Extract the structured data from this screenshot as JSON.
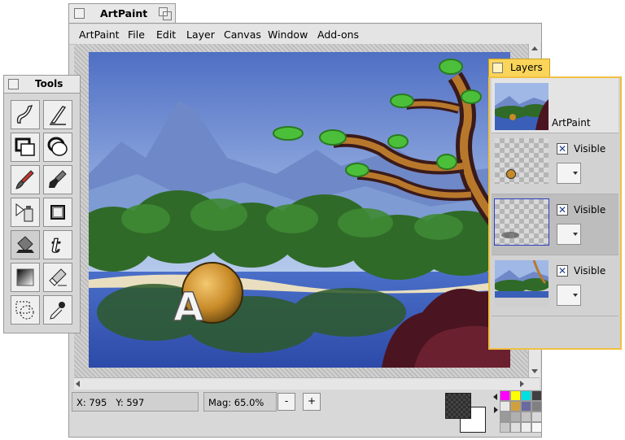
{
  "main_window": {
    "title": "ArtPaint"
  },
  "menu": [
    "ArtPaint",
    "File",
    "Edit",
    "Layer",
    "Canvas",
    "Window",
    "Add-ons"
  ],
  "status": {
    "x": "X: 795",
    "y": "Y: 597",
    "mag": "Mag: 65.0%",
    "zoom_out": "-",
    "zoom_in": "+"
  },
  "tools_window": {
    "title": "Tools",
    "tools": [
      "freehand-line-icon",
      "straight-line-icon",
      "rectangle-icon",
      "ellipse-icon",
      "brush-icon",
      "fill-brush-icon",
      "spray-icon",
      "blur-icon",
      "bucket-fill-icon",
      "text-tool-icon",
      "gradient-icon",
      "eraser-icon",
      "selection-icon",
      "color-picker-icon"
    ]
  },
  "layers_window": {
    "title": "Layers",
    "canvas_label": "ArtPaint",
    "layers": [
      {
        "visible_label": "Visible",
        "checked": true
      },
      {
        "visible_label": "Visible",
        "checked": true
      },
      {
        "visible_label": "Visible",
        "checked": true
      }
    ]
  },
  "colors": {
    "accent": "#f0c040",
    "primary_color": "#333333",
    "secondary_color": "#ffffff",
    "palette": [
      "#ff00ff",
      "#ffff00",
      "#00e0e0",
      "#404040",
      "#e8e8e8",
      "#d0a040",
      "#6a6aa0",
      "#808080",
      "#9a9a9a",
      "#b0b0b0",
      "#c4c4c4",
      "#d8d8d8",
      "#c8c8c8",
      "#dedede",
      "#eeeeee",
      "#f8f8f8"
    ]
  }
}
